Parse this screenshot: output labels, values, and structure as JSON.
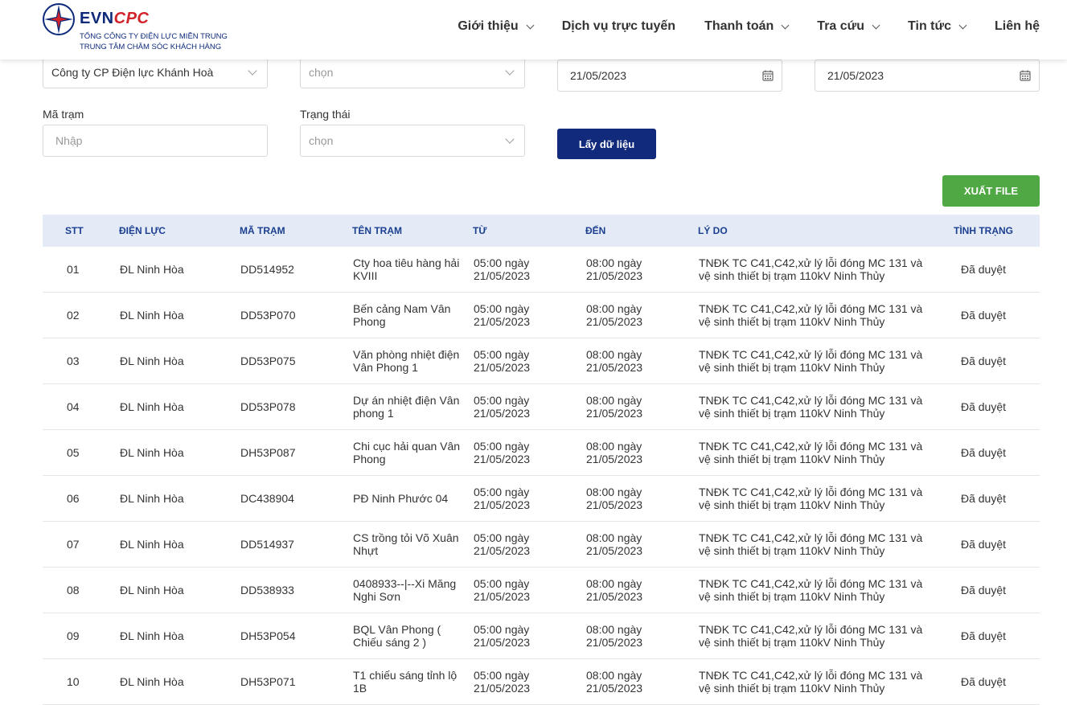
{
  "brand": {
    "evn": "EVN",
    "cpc": "CPC",
    "subtitle1": "TỔNG CÔNG TY ĐIỆN LỰC MIỀN TRUNG",
    "subtitle2": "TRUNG TÂM CHĂM SÓC KHÁCH HÀNG",
    "colors": {
      "navy": "#0d2a7a",
      "red": "#d2232a"
    }
  },
  "nav": [
    {
      "label": "Giới thiệu",
      "dropdown": true
    },
    {
      "label": "Dịch vụ trực tuyến",
      "dropdown": false
    },
    {
      "label": "Thanh toán",
      "dropdown": true
    },
    {
      "label": "Tra cứu",
      "dropdown": true
    },
    {
      "label": "Tin tức",
      "dropdown": true
    },
    {
      "label": "Liên hệ",
      "dropdown": false
    }
  ],
  "form": {
    "company_select": "Công ty CP Điện lực Khánh Hoà",
    "unit_select_placeholder": "chọn",
    "date_from": "21/05/2023",
    "date_to": "21/05/2023",
    "station_label": "Mã trạm",
    "station_placeholder": "Nhập",
    "status_label": "Trạng thái",
    "status_placeholder": "chọn",
    "fetch_button": "Lấy dữ liệu",
    "export_button": "XUẤT FILE"
  },
  "table": {
    "headers": [
      "STT",
      "ĐIỆN LỰC",
      "MÃ TRẠM",
      "TÊN TRẠM",
      "TỪ",
      "ĐẾN",
      "LÝ DO",
      "TÌNH TRẠNG"
    ],
    "rows": [
      {
        "stt": "01",
        "dien_luc": "ĐL Ninh Hòa",
        "ma_tram": "DD514952",
        "ten_tram": "Cty hoa tiêu hàng hải KVIII",
        "tu": "05:00 ngày 21/05/2023",
        "den": "08:00 ngày 21/05/2023",
        "ly_do": "TNĐK TC C41,C42,xử lý lỗi đóng MC 131 và vệ sinh thiết bị trạm 110kV Ninh Thủy",
        "tinh_trang": "Đã duyệt"
      },
      {
        "stt": "02",
        "dien_luc": "ĐL Ninh Hòa",
        "ma_tram": "DD53P070",
        "ten_tram": "Bến cảng Nam Vân Phong",
        "tu": "05:00 ngày 21/05/2023",
        "den": "08:00 ngày 21/05/2023",
        "ly_do": "TNĐK TC C41,C42,xử lý lỗi đóng MC 131 và vệ sinh thiết bị trạm 110kV Ninh Thủy",
        "tinh_trang": "Đã duyệt"
      },
      {
        "stt": "03",
        "dien_luc": "ĐL Ninh Hòa",
        "ma_tram": "DD53P075",
        "ten_tram": "Văn phòng nhiệt điện Vân Phong 1",
        "tu": "05:00 ngày 21/05/2023",
        "den": "08:00 ngày 21/05/2023",
        "ly_do": "TNĐK TC C41,C42,xử lý lỗi đóng MC 131 và vệ sinh thiết bị trạm 110kV Ninh Thủy",
        "tinh_trang": "Đã duyệt"
      },
      {
        "stt": "04",
        "dien_luc": "ĐL Ninh Hòa",
        "ma_tram": "DD53P078",
        "ten_tram": "Dự án nhiệt điện Vân phong 1",
        "tu": "05:00 ngày 21/05/2023",
        "den": "08:00 ngày 21/05/2023",
        "ly_do": "TNĐK TC C41,C42,xử lý lỗi đóng MC 131 và vệ sinh thiết bị trạm 110kV Ninh Thủy",
        "tinh_trang": "Đã duyệt"
      },
      {
        "stt": "05",
        "dien_luc": "ĐL Ninh Hòa",
        "ma_tram": "DH53P087",
        "ten_tram": "Chi cục hải quan Vân Phong",
        "tu": "05:00 ngày 21/05/2023",
        "den": "08:00 ngày 21/05/2023",
        "ly_do": "TNĐK TC C41,C42,xử lý lỗi đóng MC 131 và vệ sinh thiết bị trạm 110kV Ninh Thủy",
        "tinh_trang": "Đã duyệt"
      },
      {
        "stt": "06",
        "dien_luc": "ĐL Ninh Hòa",
        "ma_tram": "DC438904",
        "ten_tram": "PĐ Ninh Phước 04",
        "tu": "05:00 ngày 21/05/2023",
        "den": "08:00 ngày 21/05/2023",
        "ly_do": "TNĐK TC C41,C42,xử lý lỗi đóng MC 131 và vệ sinh thiết bị trạm 110kV Ninh Thủy",
        "tinh_trang": "Đã duyệt"
      },
      {
        "stt": "07",
        "dien_luc": "ĐL Ninh Hòa",
        "ma_tram": "DD514937",
        "ten_tram": "CS trồng tỏi Võ Xuân Nhựt",
        "tu": "05:00 ngày 21/05/2023",
        "den": "08:00 ngày 21/05/2023",
        "ly_do": "TNĐK TC C41,C42,xử lý lỗi đóng MC 131 và vệ sinh thiết bị trạm 110kV Ninh Thủy",
        "tinh_trang": "Đã duyệt"
      },
      {
        "stt": "08",
        "dien_luc": "ĐL Ninh Hòa",
        "ma_tram": "DD538933",
        "ten_tram": "0408933--|--Xi Măng Nghi Sơn",
        "tu": "05:00 ngày 21/05/2023",
        "den": "08:00 ngày 21/05/2023",
        "ly_do": "TNĐK TC C41,C42,xử lý lỗi đóng MC 131 và vệ sinh thiết bị trạm 110kV Ninh Thủy",
        "tinh_trang": "Đã duyệt"
      },
      {
        "stt": "09",
        "dien_luc": "ĐL Ninh Hòa",
        "ma_tram": "DH53P054",
        "ten_tram": "BQL Vân Phong ( Chiếu sáng 2 )",
        "tu": "05:00 ngày 21/05/2023",
        "den": "08:00 ngày 21/05/2023",
        "ly_do": "TNĐK TC C41,C42,xử lý lỗi đóng MC 131 và vệ sinh thiết bị trạm 110kV Ninh Thủy",
        "tinh_trang": "Đã duyệt"
      },
      {
        "stt": "10",
        "dien_luc": "ĐL Ninh Hòa",
        "ma_tram": "DH53P071",
        "ten_tram": "T1 chiếu sáng tỉnh lộ 1B",
        "tu": "05:00 ngày 21/05/2023",
        "den": "08:00 ngày 21/05/2023",
        "ly_do": "TNĐK TC C41,C42,xử lý lỗi đóng MC 131 và vệ sinh thiết bị trạm 110kV Ninh Thủy",
        "tinh_trang": "Đã duyệt"
      }
    ]
  }
}
